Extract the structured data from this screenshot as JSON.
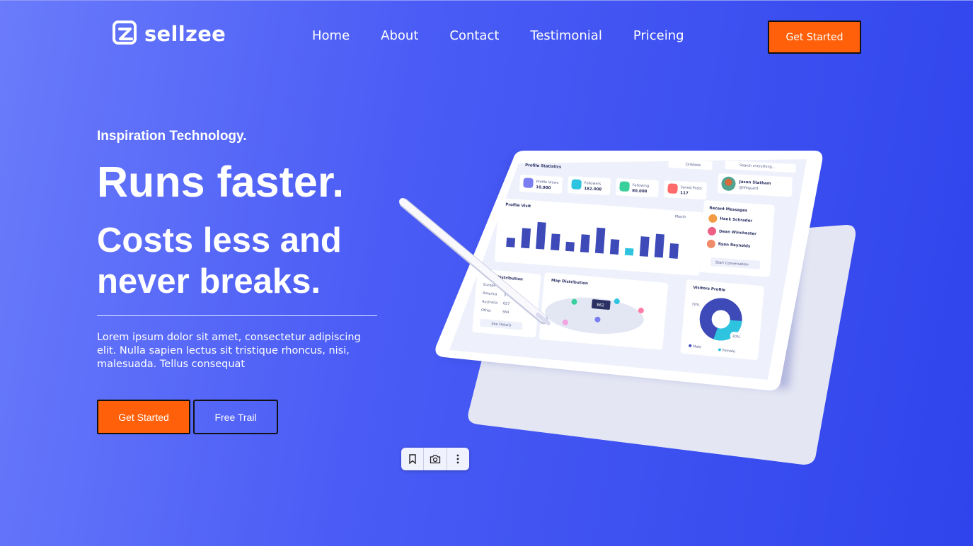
{
  "brand": {
    "name": "sellzee"
  },
  "nav": {
    "items": [
      "Home",
      "About",
      "Contact",
      "Testimonial",
      "Priceing"
    ]
  },
  "header": {
    "cta_label": "Get Started"
  },
  "hero": {
    "eyebrow": "Inspiration Technology.",
    "headline": "Runs faster.",
    "subheadline": "Costs less and never breaks.",
    "body": "Lorem ipsum dolor sit amet, consectetur adipiscing elit. Nulla sapien lectus sit tristique rhoncus, nisi, malesuada. Tellus consequat",
    "primary_cta": "Get Started",
    "secondary_cta": "Free Trail"
  },
  "dashboard": {
    "title": "Profile Statistics",
    "source_select": "Dribbble",
    "search_placeholder": "Search everything...",
    "stats": [
      {
        "label": "Profile Views",
        "value": "10.900",
        "color": "#7a7ef0"
      },
      {
        "label": "Followers",
        "value": "182.008",
        "color": "#2ec4e0"
      },
      {
        "label": "Following",
        "value": "80.008",
        "color": "#37cf9a"
      },
      {
        "label": "Saved Posts",
        "value": "117",
        "color": "#ff6b6b"
      }
    ],
    "profile": {
      "name": "Jason Statham",
      "handle": "@lifeguard"
    },
    "visit_chart": {
      "title": "Profile Visit",
      "period": "Month"
    },
    "messages": {
      "title": "Recent Messages",
      "items": [
        "Hank Schrader",
        "Dean Winchester",
        "Ryan Reynolds"
      ],
      "button": "Start Conversation"
    },
    "distribution": {
      "title": "Distribution",
      "rows": [
        "Europe",
        "America",
        "Australia",
        "Other"
      ],
      "values": [
        "",
        "375",
        "657",
        "564"
      ],
      "button": "See Details"
    },
    "map": {
      "title": "Map Distribution",
      "badge": "862"
    },
    "visitors": {
      "title": "Visitors Profile",
      "male_pct": "70%",
      "female_pct": "30%",
      "legend": [
        "Male",
        "Female"
      ]
    }
  },
  "toolbar": {
    "icons": [
      "bookmark-icon",
      "camera-search-icon",
      "more-vertical-icon"
    ]
  },
  "colors": {
    "accent": "#ff6009",
    "bg_start": "#6a7bfb",
    "bg_end": "#2f44ec"
  }
}
